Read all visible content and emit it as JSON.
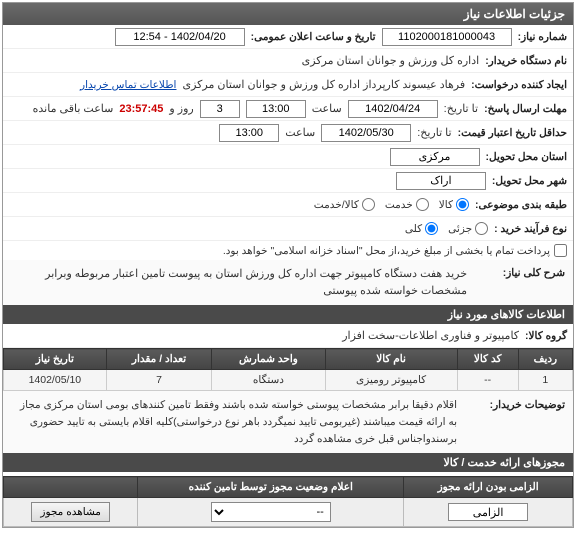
{
  "panel": {
    "title": "جزئیات اطلاعات نیاز"
  },
  "fields": {
    "need_no_lbl": "شماره نیاز:",
    "need_no": "1102000181000043",
    "announce_lbl": "تاریخ و ساعت اعلان عمومی:",
    "announce_val": "1402/04/20 - 12:54",
    "buyer_org_lbl": "نام دستگاه خریدار:",
    "buyer_org": "اداره کل ورزش و جوانان استان مرکزی",
    "requester_lbl": "ایجاد کننده درخواست:",
    "requester": "فرهاد عیسوند کارپرداز اداره کل ورزش و جوانان استان مرکزی",
    "contact_link": "اطلاعات تماس خریدار",
    "deadline_lbl": "مهلت ارسال پاسخ:",
    "deadline_ta": "تا تاریخ:",
    "deadline_date": "1402/04/24",
    "deadline_saat": "ساعت",
    "deadline_time": "13:00",
    "deadline_rooz": "روز و",
    "days_left": "3",
    "remain_time": "23:57:45",
    "remain_lbl": "ساعت باقی مانده",
    "min_validity_lbl": "حداقل تاریخ اعتبار قیمت:",
    "min_validity_ta": "تا تاریخ:",
    "min_validity_date": "1402/05/30",
    "min_validity_saat": "ساعت",
    "min_validity_time": "13:00",
    "install_state_lbl": "استان محل تحویل:",
    "install_state": "مرکزی",
    "install_city_lbl": "شهر محل تحویل:",
    "install_city": "اراک",
    "cls_lbl": "طبقه بندی موضوعی:",
    "cls_goods": "کالا",
    "cls_service": "خدمت",
    "cls_both": "کالا/خدمت",
    "proc_lbl": "نوع فرآیند خرید :",
    "proc_partial": "جزئی",
    "proc_full": "کلی",
    "pay_note": "پرداخت تمام یا بخشی از مبلغ خرید،از محل \"اسناد خزانه اسلامی\" خواهد بود.",
    "pay_checked": false
  },
  "general_desc": {
    "lbl": "شرح کلی نیاز:",
    "text": "خرید هفت دستگاه کامپیوتر جهت اداره کل ورزش استان به پیوست تامین اعتبار مربوطه وبرابر مشخصات خواسته شده پیوستی"
  },
  "goods_section": "اطلاعات کالاهای مورد نیاز",
  "goods_group_lbl": "گروه کالا:",
  "goods_group": "کامپیوتر و فناوری اطلاعات-سخت افزار",
  "table": {
    "headers": [
      "ردیف",
      "کد کالا",
      "نام کالا",
      "واحد شمارش",
      "تعداد / مقدار",
      "تاریخ نیاز"
    ],
    "rows": [
      {
        "idx": "1",
        "code": "--",
        "name": "کامپیوتر رومیزی",
        "unit": "دستگاه",
        "qty": "7",
        "date": "1402/05/10"
      }
    ]
  },
  "buyer_notes": {
    "lbl": "توضیحات خریدار:",
    "text": "اقلام دقیقا برابر مشخصات پیوستی خواسته شده باشند وفقط تامین کنندهای بومی استان مرکزی مجاز به ارائه قیمت میباشند (غیربومی تایید نمیگردد باهر نوع درخواستی)کلیه اقلام بایستی به تایید حضوری برسندواجناس قبل خری مشاهده گردد"
  },
  "permits_section": "مجوزهای ارائه خدمت / کالا",
  "permits_table": {
    "headers": [
      "الزامی بودن ارائه مجوز",
      "اعلام وضعیت مجوز توسط تامین کننده",
      ""
    ],
    "mandatory": "الزامی",
    "status_placeholder": "--",
    "view_btn": "مشاهده مجوز"
  }
}
